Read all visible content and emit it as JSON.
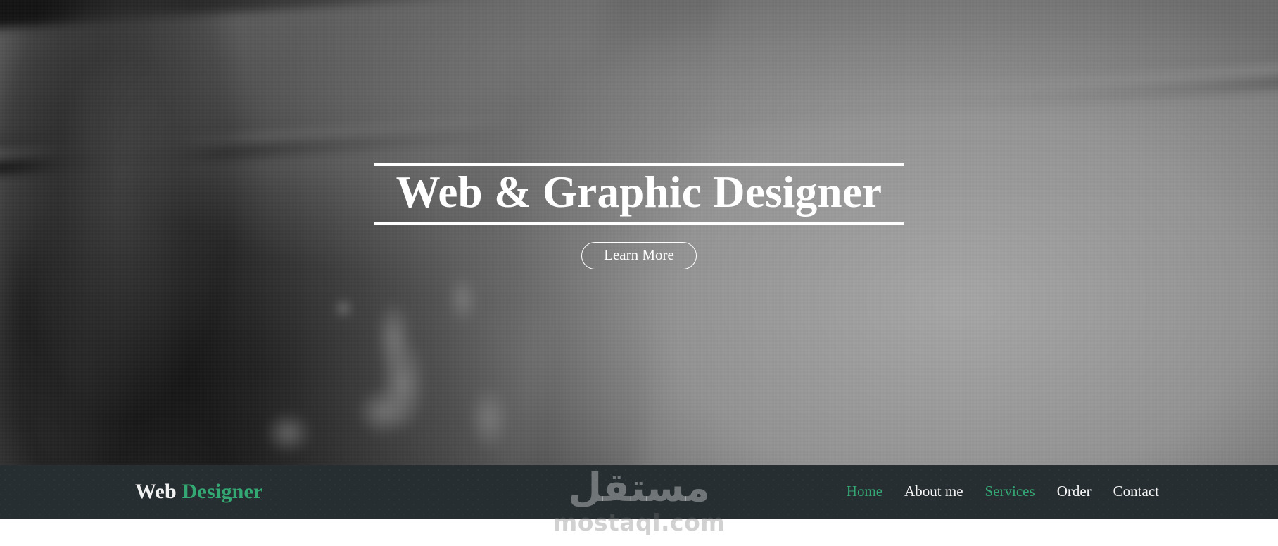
{
  "hero": {
    "title": "Web & Graphic Designer",
    "cta_label": "Learn More",
    "background_description": "blurred-black-and-white-photo-of-video-camera-rig"
  },
  "navbar": {
    "brand": {
      "prefix": "Web",
      "accent": "Designer"
    },
    "links": [
      {
        "label": "Home",
        "accent": true
      },
      {
        "label": "About me",
        "accent": false
      },
      {
        "label": "Services",
        "accent": true
      },
      {
        "label": "Order",
        "accent": false
      },
      {
        "label": "Contact",
        "accent": false
      }
    ]
  },
  "watermark": {
    "arabic": "مستقل",
    "latin": "mostaql.com"
  },
  "colors": {
    "accent_green": "#34a873",
    "navbar_bg": "#262e31",
    "text_light": "#f4f4f4",
    "page_bg": "#ffffff"
  }
}
